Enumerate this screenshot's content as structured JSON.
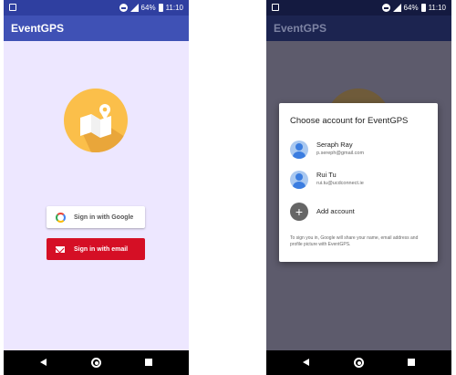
{
  "status_bar": {
    "battery": "64%",
    "time": "11:10"
  },
  "app": {
    "title": "EventGPS"
  },
  "login": {
    "google_button": "Sign in with Google",
    "email_button": "Sign in with email"
  },
  "dialog": {
    "title": "Choose account for EventGPS",
    "accounts": [
      {
        "name": "Seraph Ray",
        "email": "p.sereph@gmail.com"
      },
      {
        "name": "Rui Tu",
        "email": "rui.tu@ucdconnect.ie"
      }
    ],
    "add_account": "Add account",
    "privacy_text": "To sign you in, Google will share your name, email address and profile picture with EventGPS."
  },
  "colors": {
    "primary": "#3f51b5",
    "status_bar": "#2f3fa0",
    "background": "#ede7ff",
    "email_button": "#d50f25",
    "logo": "#fbbf4a"
  },
  "icons": [
    "notification-icon",
    "dnd-icon",
    "signal-icon",
    "battery-icon",
    "map-pin-logo",
    "google-icon",
    "mail-icon",
    "back-icon",
    "home-icon",
    "recents-icon",
    "avatar-icon",
    "add-account-icon"
  ]
}
